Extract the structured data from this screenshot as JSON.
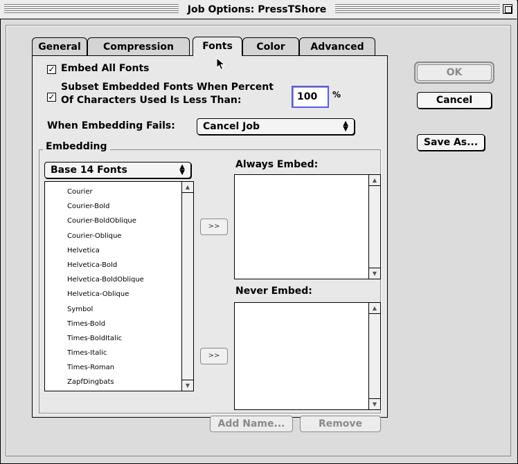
{
  "window": {
    "title": "Job Options: PressTShore"
  },
  "tabs": [
    {
      "label": "General",
      "active": false
    },
    {
      "label": "Compression",
      "active": false
    },
    {
      "label": "Fonts",
      "active": true
    },
    {
      "label": "Color",
      "active": false
    },
    {
      "label": "Advanced",
      "active": false
    }
  ],
  "fonts": {
    "embed_all": {
      "label": "Embed All Fonts",
      "checked": true,
      "mark": "✓"
    },
    "subset": {
      "label_line1": "Subset Embedded Fonts When Percent",
      "label_line2": "Of Characters Used Is Less Than:",
      "checked": true,
      "mark": "✓",
      "value": "100",
      "unit": "%"
    },
    "embed_fail": {
      "label": "When Embedding Fails:",
      "selected": "Cancel Job"
    },
    "embedding": {
      "group_label": "Embedding",
      "source_popup": "Base 14 Fonts",
      "font_list": [
        "Courier",
        "Courier-Bold",
        "Courier-BoldOblique",
        "Courier-Oblique",
        "Helvetica",
        "Helvetica-Bold",
        "Helvetica-BoldOblique",
        "Helvetica-Oblique",
        "Symbol",
        "Times-Bold",
        "Times-BoldItalic",
        "Times-Italic",
        "Times-Roman",
        "ZapfDingbats"
      ],
      "always_embed_label": "Always Embed:",
      "never_embed_label": "Never Embed:",
      "move_button_label": ">>",
      "add_name_label": "Add Name...",
      "remove_label": "Remove"
    }
  },
  "buttons": {
    "ok": "OK",
    "cancel": "Cancel",
    "save_as": "Save As..."
  }
}
